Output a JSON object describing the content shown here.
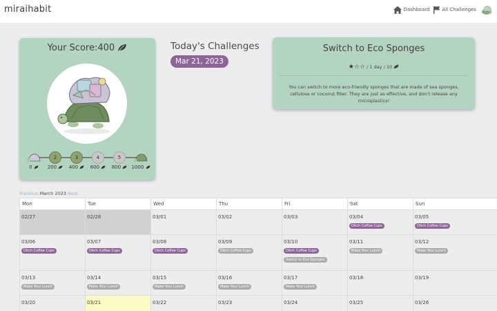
{
  "app": {
    "brand": "miraihabit"
  },
  "nav": {
    "dashboard": "Dashboard",
    "all_challenges": "All Challenges"
  },
  "score": {
    "title": "Your Score:400",
    "milestones": [
      {
        "level": "",
        "points": "0",
        "state": "avatar"
      },
      {
        "level": "2",
        "points": "200",
        "state": "done"
      },
      {
        "level": "3",
        "points": "400",
        "state": "done"
      },
      {
        "level": "4",
        "points": "600",
        "state": "locked"
      },
      {
        "level": "5",
        "points": "800",
        "state": "locked"
      },
      {
        "level": "",
        "points": "1000",
        "state": "avatar"
      }
    ]
  },
  "today": {
    "heading": "Today's Challenges",
    "date": "Mar 21, 2023"
  },
  "challenge": {
    "title": "Switch to Eco Sponges",
    "rating": 1,
    "rating_max": 3,
    "frequency": "/ 1 day / 10",
    "description": "You can switch to more eco-friendly sponges that are made of sea sponges, cellulose or coconut fiber. They are just as effective, and don't release any microplastics!"
  },
  "calendar": {
    "prev": "Previous",
    "month": "March 2023",
    "next": "Next",
    "weekdays": [
      "Mon",
      "Tue",
      "Wed",
      "Thu",
      "Fri",
      "Sat",
      "Sun"
    ],
    "weeks": [
      [
        {
          "date": "02/27",
          "style": "dim",
          "tags": []
        },
        {
          "date": "02/28",
          "style": "dim",
          "tags": []
        },
        {
          "date": "03/01",
          "style": "",
          "tags": []
        },
        {
          "date": "03/02",
          "style": "",
          "tags": []
        },
        {
          "date": "03/03",
          "style": "",
          "tags": []
        },
        {
          "date": "03/04",
          "style": "",
          "tags": [
            {
              "label": "Ditch Coffee Cups",
              "color": "purple"
            }
          ]
        },
        {
          "date": "03/05",
          "style": "",
          "tags": [
            {
              "label": "Ditch Coffee Cups",
              "color": "purple"
            }
          ]
        }
      ],
      [
        {
          "date": "03/06",
          "style": "",
          "tags": [
            {
              "label": "Ditch Coffee Cups",
              "color": "purple"
            }
          ]
        },
        {
          "date": "03/07",
          "style": "",
          "tags": [
            {
              "label": "Ditch Coffee Cups",
              "color": "purple"
            }
          ]
        },
        {
          "date": "03/08",
          "style": "",
          "tags": [
            {
              "label": "Ditch Coffee Cups",
              "color": "purple"
            }
          ]
        },
        {
          "date": "03/09",
          "style": "",
          "tags": [
            {
              "label": "Ditch Coffee Cups",
              "color": "grey"
            }
          ]
        },
        {
          "date": "03/10",
          "style": "",
          "tags": [
            {
              "label": "Ditch Coffee Cups",
              "color": "purple"
            },
            {
              "label": "Switch to Eco Sponges",
              "color": "grey"
            }
          ]
        },
        {
          "date": "03/11",
          "style": "",
          "tags": [
            {
              "label": "Make Your Lunch",
              "color": "grey"
            }
          ]
        },
        {
          "date": "03/12",
          "style": "",
          "tags": [
            {
              "label": "Make Your Lunch",
              "color": "grey"
            }
          ]
        }
      ],
      [
        {
          "date": "03/13",
          "style": "",
          "tags": [
            {
              "label": "Make Your Lunch",
              "color": "grey"
            }
          ]
        },
        {
          "date": "03/14",
          "style": "",
          "tags": [
            {
              "label": "Make Your Lunch",
              "color": "grey"
            }
          ]
        },
        {
          "date": "03/15",
          "style": "",
          "tags": [
            {
              "label": "Make Your Lunch",
              "color": "grey"
            }
          ]
        },
        {
          "date": "03/16",
          "style": "",
          "tags": [
            {
              "label": "Make Your Lunch",
              "color": "grey"
            }
          ]
        },
        {
          "date": "03/17",
          "style": "",
          "tags": [
            {
              "label": "Make Your Lunch",
              "color": "grey"
            }
          ]
        },
        {
          "date": "03/18",
          "style": "",
          "tags": []
        },
        {
          "date": "03/19",
          "style": "",
          "tags": []
        }
      ],
      [
        {
          "date": "03/20",
          "style": "",
          "tags": []
        },
        {
          "date": "03/21",
          "style": "today",
          "tags": []
        },
        {
          "date": "03/22",
          "style": "",
          "tags": []
        },
        {
          "date": "03/23",
          "style": "",
          "tags": []
        },
        {
          "date": "03/24",
          "style": "",
          "tags": []
        },
        {
          "date": "03/25",
          "style": "",
          "tags": []
        },
        {
          "date": "03/26",
          "style": "",
          "tags": []
        }
      ]
    ]
  },
  "colors": {
    "accent_purple": "#8b6696",
    "card_green": "#b4d4c2",
    "today_yellow": "#fbfbc6",
    "dim_cell": "#d1d1d1"
  }
}
